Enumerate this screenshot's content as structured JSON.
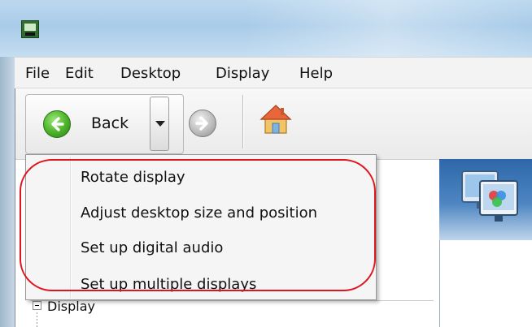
{
  "window": {
    "app_icon": "display-control-app-icon"
  },
  "menubar": {
    "items": [
      "File",
      "Edit",
      "Desktop",
      "Display",
      "Help"
    ]
  },
  "toolbar": {
    "back_label": "Back",
    "back_icon": "green-back-arrow-icon",
    "forward_icon": "gray-forward-arrow-icon",
    "dropdown_icon": "chevron-down-icon",
    "home_icon": "home-icon"
  },
  "dropdown": {
    "items": [
      "Rotate display",
      "Adjust desktop size and position",
      "Set up digital audio",
      "Set up multiple displays"
    ]
  },
  "tree": {
    "items": [
      "Display"
    ]
  },
  "side_panel": {
    "icon": "multiple-monitors-icon"
  },
  "annotation": {
    "color": "#e0141e"
  }
}
